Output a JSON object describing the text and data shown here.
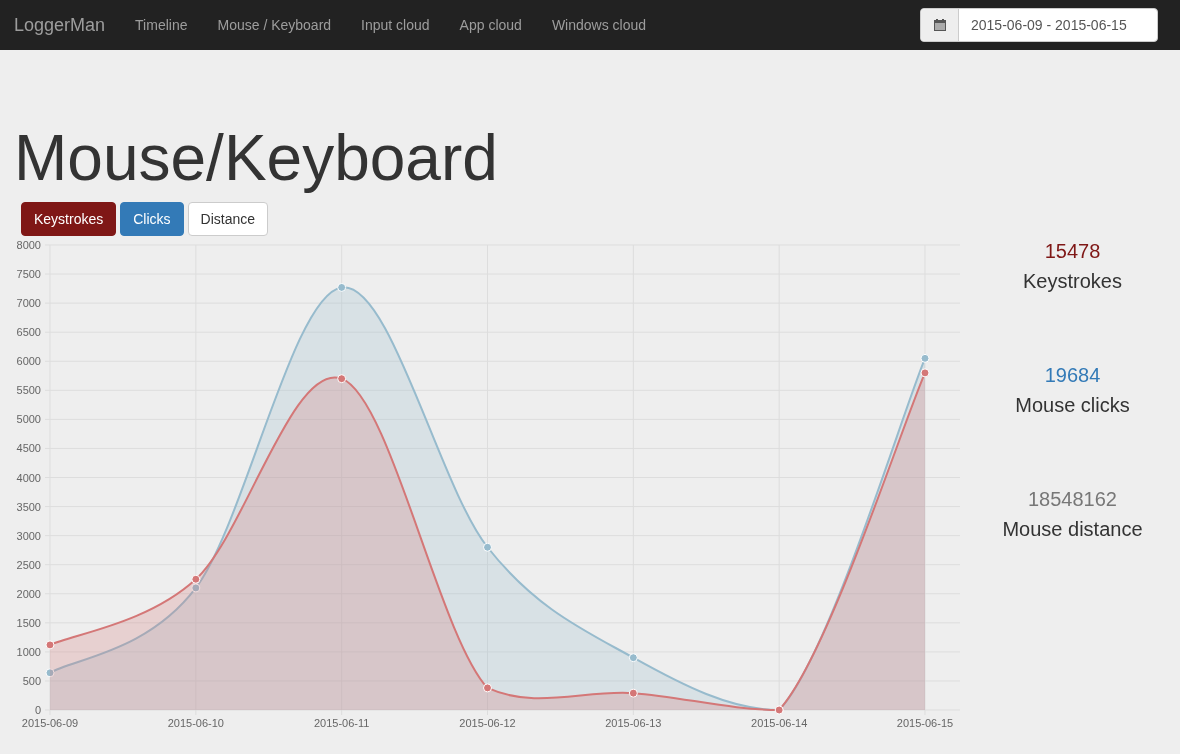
{
  "navbar": {
    "brand": "LoggerMan",
    "links": [
      {
        "label": "Timeline",
        "selected": false
      },
      {
        "label": "Mouse / Keyboard",
        "selected": false
      },
      {
        "label": "Input cloud",
        "selected": false
      },
      {
        "label": "App cloud",
        "selected": false
      },
      {
        "label": "Windows cloud",
        "selected": false
      }
    ],
    "date_range": "2015-06-09 - 2015-06-15"
  },
  "page_title": "Mouse/Keyboard",
  "toggles": [
    {
      "label": "Keystrokes",
      "selected": true,
      "color": "#7f1716"
    },
    {
      "label": "Clicks",
      "selected": true,
      "color": "#337ab7"
    },
    {
      "label": "Distance",
      "selected": false
    }
  ],
  "chart_data": {
    "type": "area",
    "grid": true,
    "categories": [
      "2015-06-09",
      "2015-06-10",
      "2015-06-11",
      "2015-06-12",
      "2015-06-13",
      "2015-06-14",
      "2015-06-15"
    ],
    "ylim": [
      0,
      8000
    ],
    "yticks": [
      0,
      500,
      1000,
      1500,
      2000,
      2500,
      3000,
      3500,
      4000,
      4500,
      5000,
      5500,
      6000,
      6500,
      7000,
      7500,
      8000
    ],
    "series": [
      {
        "color": "#97bbcd",
        "values": [
          640,
          2100,
          7270,
          2800,
          900,
          0,
          6050
        ]
      },
      {
        "color": "#d47777",
        "values": [
          1120,
          2250,
          5700,
          380,
          290,
          0,
          5800
        ]
      }
    ]
  },
  "stats": [
    {
      "value": "15478",
      "label": "Keystrokes",
      "color": "#7f1716"
    },
    {
      "value": "19684",
      "label": "Mouse clicks",
      "color": "#337ab7"
    },
    {
      "value": "18548162",
      "label": "Mouse distance",
      "color": "#777777"
    }
  ]
}
